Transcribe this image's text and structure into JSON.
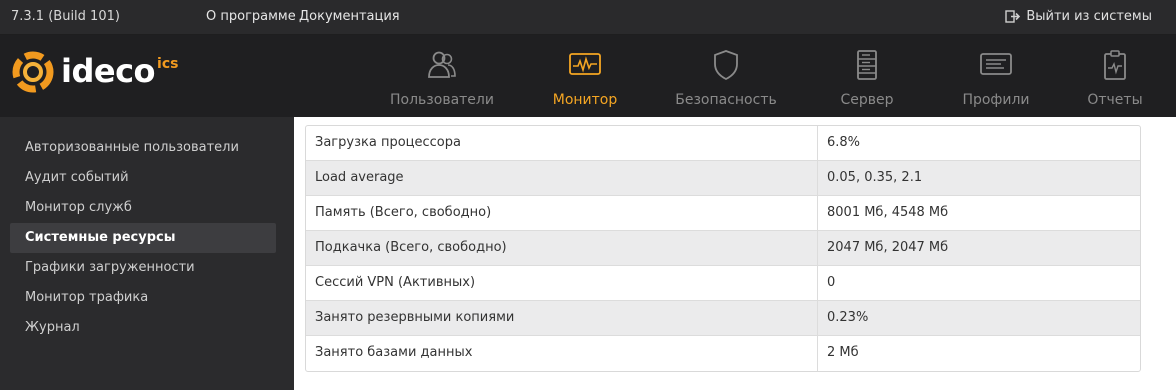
{
  "topbar": {
    "version": "7.3.1 (Build 101)",
    "links": [
      "О программе",
      "Документация"
    ],
    "logout_label": "Выйти из системы",
    "logout_icon": "logout-icon"
  },
  "logo": {
    "text": "ideco",
    "sup": "ics",
    "icon": "ideco-logo-icon"
  },
  "nav": {
    "tabs": [
      {
        "label": "Пользователи",
        "icon": "users-icon",
        "active": false
      },
      {
        "label": "Монитор",
        "icon": "monitor-icon",
        "active": true
      },
      {
        "label": "Безопасность",
        "icon": "shield-icon",
        "active": false
      },
      {
        "label": "Сервер",
        "icon": "server-icon",
        "active": false
      },
      {
        "label": "Профили",
        "icon": "profile-card-icon",
        "active": false
      },
      {
        "label": "Отчеты",
        "icon": "report-clipboard-icon",
        "active": false
      }
    ]
  },
  "sidebar": {
    "items": [
      {
        "label": "Авторизованные пользователи",
        "active": false
      },
      {
        "label": "Аудит событий",
        "active": false
      },
      {
        "label": "Монитор служб",
        "active": false
      },
      {
        "label": "Системные ресурсы",
        "active": true
      },
      {
        "label": "Графики загруженности",
        "active": false
      },
      {
        "label": "Монитор трафика",
        "active": false
      },
      {
        "label": "Журнал",
        "active": false
      }
    ]
  },
  "resources": {
    "rows": [
      {
        "key": "Загрузка процессора",
        "value": "6.8%"
      },
      {
        "key": "Load average",
        "value": "0.05, 0.35, 2.1"
      },
      {
        "key": "Память (Всего, свободно)",
        "value": "8001 Мб, 4548 Мб"
      },
      {
        "key": "Подкачка (Всего, свободно)",
        "value": "2047 Мб, 2047 Мб"
      },
      {
        "key": "Сессий VPN (Активных)",
        "value": "0"
      },
      {
        "key": "Занято резервными копиями",
        "value": "0.23%"
      },
      {
        "key": "Занято базами данных",
        "value": "2 Мб"
      }
    ]
  },
  "colors": {
    "accent": "#f5a623",
    "topbar_bg": "#2a2a2c",
    "header_bg": "#1f1f21",
    "sidebar_active_bg": "#3d3d40",
    "row_alt_bg": "#ebebec"
  }
}
